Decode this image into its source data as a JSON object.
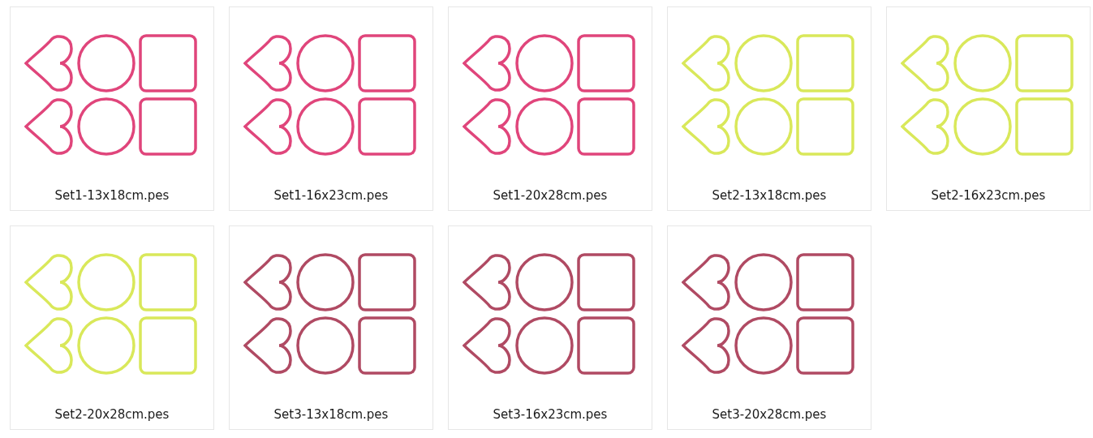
{
  "files": [
    {
      "name": "Set1-13x18cm.pes",
      "color": "#e0457b"
    },
    {
      "name": "Set1-16x23cm.pes",
      "color": "#e0457b"
    },
    {
      "name": "Set1-20x28cm.pes",
      "color": "#e0457b"
    },
    {
      "name": "Set2-13x18cm.pes",
      "color": "#d9e85a"
    },
    {
      "name": "Set2-16x23cm.pes",
      "color": "#d9e85a"
    },
    {
      "name": "Set2-20x28cm.pes",
      "color": "#d9e85a"
    },
    {
      "name": "Set3-13x18cm.pes",
      "color": "#b04a63"
    },
    {
      "name": "Set3-16x23cm.pes",
      "color": "#b04a63"
    },
    {
      "name": "Set3-20x28cm.pes",
      "color": "#b04a63"
    }
  ]
}
